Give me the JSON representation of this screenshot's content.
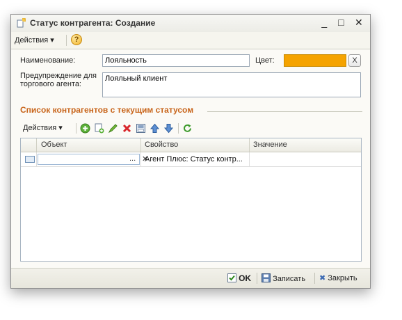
{
  "window": {
    "title": "Статус контрагента: Создание",
    "controls": {
      "minimize": "_",
      "maximize": "□",
      "close": "✕"
    }
  },
  "menubar": {
    "actions_label": "Действия ▾",
    "help_label": "?"
  },
  "form": {
    "name_label": "Наименование:",
    "name_value": "Лояльность",
    "color_label": "Цвет:",
    "color_value": "#f5a300",
    "color_clear_label": "X",
    "warning_label_line1": "Предупреждение для",
    "warning_label_line2": "торгового агента:",
    "warning_value": "Лояльный клиент"
  },
  "section": {
    "title": "Список контрагентов с текущим статусом"
  },
  "toolbar": {
    "actions_label": "Действия ▾",
    "icons": [
      "add-icon",
      "copy-icon",
      "edit-icon",
      "delete-icon",
      "report-icon",
      "move-up-icon",
      "move-down-icon",
      "refresh-icon"
    ]
  },
  "table": {
    "columns": [
      "Объект",
      "Свойство",
      "Значение"
    ],
    "rows": [
      {
        "object": "",
        "object_select": "...",
        "object_clear": "✕",
        "property": "Агент Плюс: Статус контр...",
        "value": ""
      }
    ]
  },
  "footer": {
    "ok_label": "OK",
    "save_label": "Записать",
    "close_label": "Закрыть"
  },
  "colors": {
    "accent": "#c8641a",
    "swatch": "#f5a300"
  }
}
